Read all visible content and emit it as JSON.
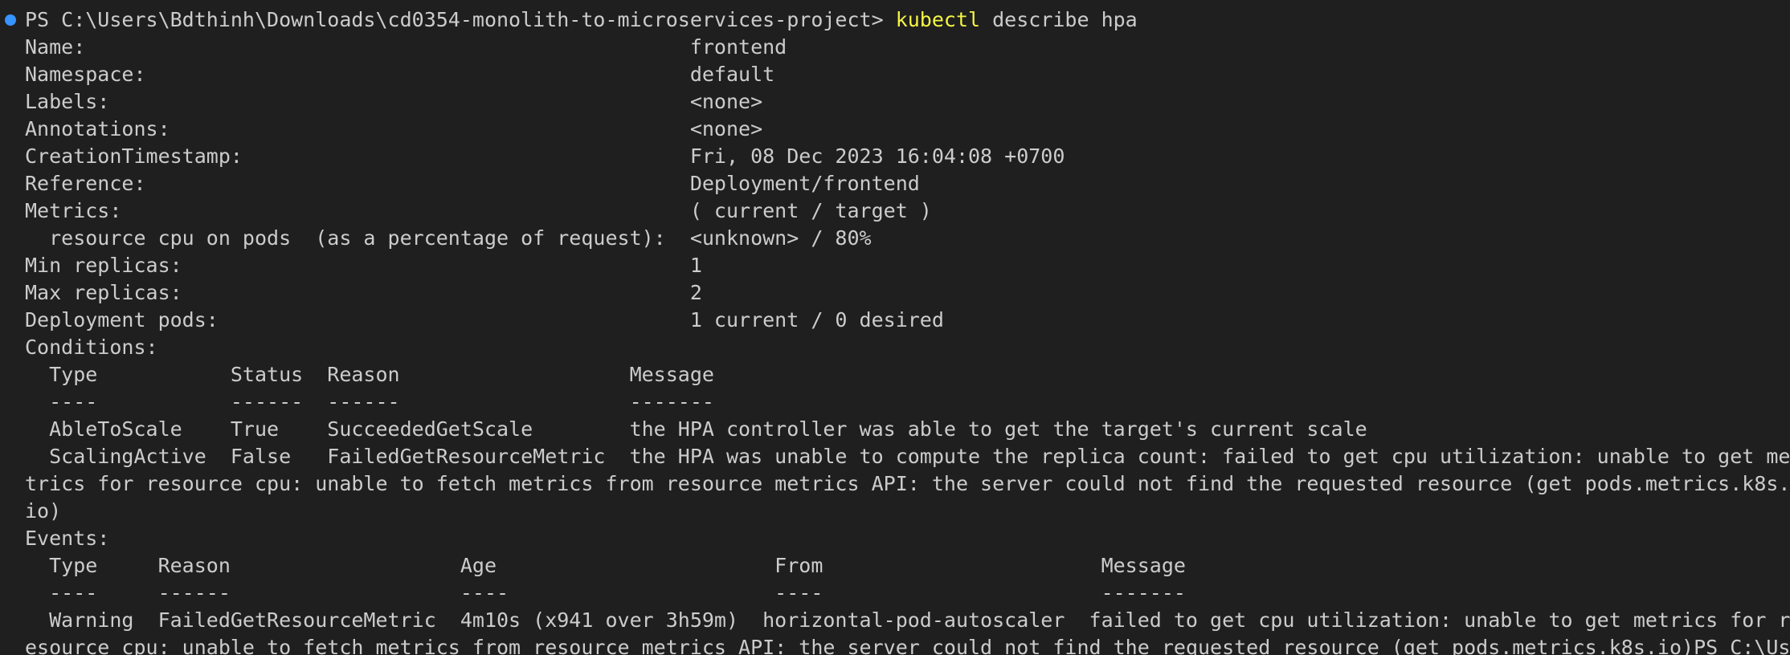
{
  "colors": {
    "background": "#1f1f1f",
    "text": "#cccccc",
    "command": "#f5f543",
    "prompt_dot": "#3794ff"
  },
  "prompt": {
    "path": "PS C:\\Users\\Bdthinh\\Downloads\\cd0354-monolith-to-microservices-project> ",
    "command": "kubectl",
    "args": " describe hpa"
  },
  "lines": [
    "Name:                                                  frontend",
    "Namespace:                                             default",
    "Labels:                                                <none>",
    "Annotations:                                           <none>",
    "CreationTimestamp:                                     Fri, 08 Dec 2023 16:04:08 +0700",
    "Reference:                                             Deployment/frontend",
    "Metrics:                                               ( current / target )",
    "  resource cpu on pods  (as a percentage of request):  <unknown> / 80%",
    "Min replicas:                                          1",
    "Max replicas:                                          2",
    "Deployment pods:                                       1 current / 0 desired",
    "Conditions:",
    "  Type           Status  Reason                   Message",
    "  ----           ------  ------                   -------",
    "  AbleToScale    True    SucceededGetScale        the HPA controller was able to get the target's current scale",
    "  ScalingActive  False   FailedGetResourceMetric  the HPA was unable to compute the replica count: failed to get cpu utilization: unable to get me",
    "trics for resource cpu: unable to fetch metrics from resource metrics API: the server could not find the requested resource (get pods.metrics.k8s.",
    "io)",
    "Events:",
    "  Type     Reason                   Age                       From                       Message",
    "  ----     ------                   ----                      ----                       -------",
    "  Warning  FailedGetResourceMetric  4m10s (x941 over 3h59m)  horizontal-pod-autoscaler  failed to get cpu utilization: unable to get metrics for r",
    "esource cpu: unable to fetch metrics from resource metrics API: the server could not find the requested resource (get pods.metrics.k8s.io)PS C:\\Us"
  ]
}
